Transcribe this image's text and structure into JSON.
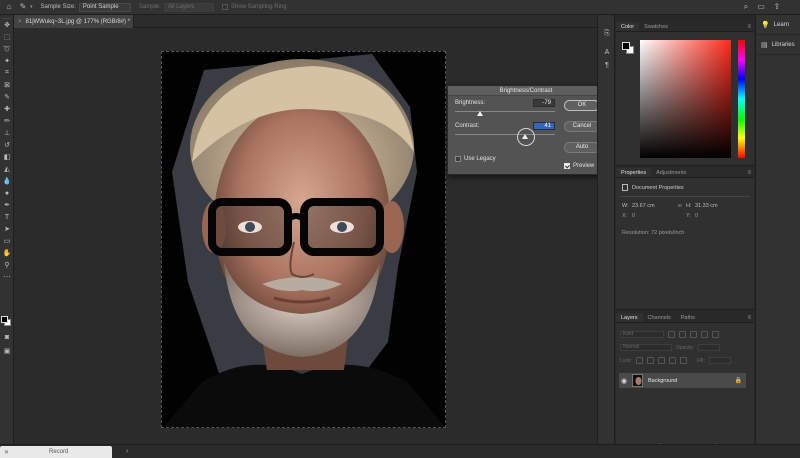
{
  "options_bar": {
    "sample_size_label": "Sample Size:",
    "sample_size_value": "Point Sample",
    "sample_label": "Sample:",
    "sample_value": "All Layers",
    "show_ring_label": "Show Sampling Ring"
  },
  "document": {
    "tab_title": "81jWWukq~3L.jpg @ 177% (RGB/8#) *"
  },
  "dialog": {
    "title": "Brightness/Contrast",
    "brightness_label": "Brightness:",
    "brightness_value": "-79",
    "contrast_label": "Contrast:",
    "contrast_value": "41",
    "use_legacy_label": "Use Legacy",
    "use_legacy_checked": false,
    "preview_label": "Preview",
    "preview_checked": true,
    "ok_label": "OK",
    "cancel_label": "Cancel",
    "auto_label": "Auto"
  },
  "color_panel": {
    "tabs": [
      "Color",
      "Swatches"
    ],
    "foreground": "#000000",
    "background": "#ffffff"
  },
  "properties_panel": {
    "tabs": [
      "Properties",
      "Adjustments"
    ],
    "section": "Document Properties",
    "w_label": "W:",
    "w_value": "23.67 cm",
    "h_label": "H:",
    "h_value": "31.33 cm",
    "x_label": "X:",
    "x_value": "0",
    "y_label": "Y:",
    "y_value": "0",
    "resolution": "Resolution: 72 pixels/inch"
  },
  "layers_panel": {
    "tabs": [
      "Layers",
      "Channels",
      "Paths"
    ],
    "kind_label": "Kind",
    "blend_mode": "Normal",
    "opacity_label": "Opacity:",
    "lock_label": "Lock:",
    "fill_label": "Fill:",
    "layer_name": "Background"
  },
  "right_column": {
    "learn_label": "Learn",
    "libraries_label": "Libraries"
  },
  "status": {
    "record_label": "Record"
  }
}
